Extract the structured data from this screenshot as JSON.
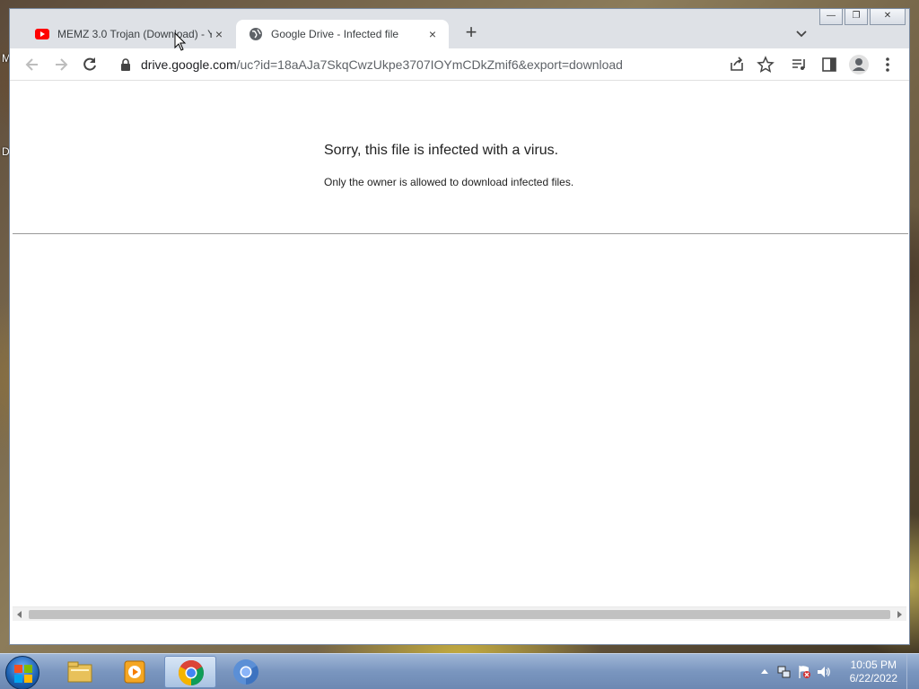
{
  "desktop": {
    "letters": [
      "M",
      "D"
    ]
  },
  "browser": {
    "tabs": [
      {
        "title": "MEMZ 3.0 Trojan (Download) - Y",
        "close": "×",
        "favicon": "youtube-icon"
      },
      {
        "title": "Google Drive - Infected file",
        "close": "×",
        "favicon": "globe-icon"
      }
    ],
    "new_tab": "+",
    "window_controls": {
      "minimize": "—",
      "restore": "❐",
      "close": "✕"
    },
    "address": {
      "host": "drive.google.com",
      "path": "/uc?id=18aAJa7SkqCwzUkpe3707IOYmCDkZmif6&export=download"
    }
  },
  "page": {
    "title": "Sorry, this file is infected with a virus.",
    "body": "Only the owner is allowed to download infected files."
  },
  "taskbar": {
    "apps": [
      "explorer-icon",
      "media-player-icon",
      "chrome-icon",
      "chromium-icon"
    ],
    "clock": {
      "time": "10:05 PM",
      "date": "6/22/2022"
    }
  },
  "colors": {
    "taskbar": "#7a96bf",
    "tabstrip": "#dee1e6",
    "youtube": "#ff0000"
  }
}
